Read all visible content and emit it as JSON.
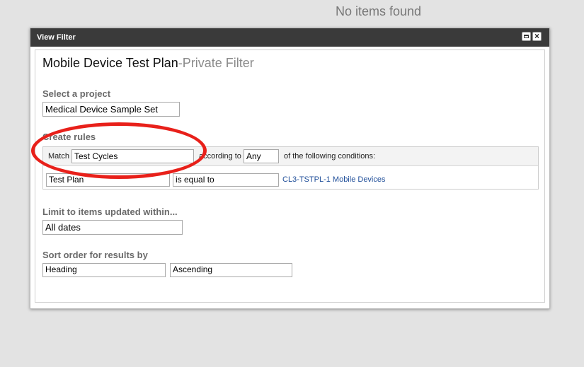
{
  "background_message": "No items found",
  "dialog": {
    "title": "View Filter",
    "filter_name": "Mobile Device Test Plan",
    "filter_separator": "-",
    "filter_scope": "Private Filter"
  },
  "project": {
    "label": "Select a project",
    "value": "Medical Device Sample Set"
  },
  "rules": {
    "label": "Create rules",
    "match_label": "Match",
    "match_value": "Test Cycles",
    "according_label": "according to",
    "according_value": "Any",
    "conditions_label": "of the following conditions:",
    "condition": {
      "field": "Test Plan",
      "operator": "is equal to",
      "value": "CL3-TSTPL-1 Mobile Devices"
    }
  },
  "limit": {
    "label": "Limit to items updated within...",
    "value": "All dates"
  },
  "sort": {
    "label": "Sort order for results by",
    "field": "Heading",
    "direction": "Ascending"
  },
  "colors": {
    "titlebar": "#3a3a3a",
    "annotation": "#e8201a",
    "link": "#1f4e99"
  }
}
